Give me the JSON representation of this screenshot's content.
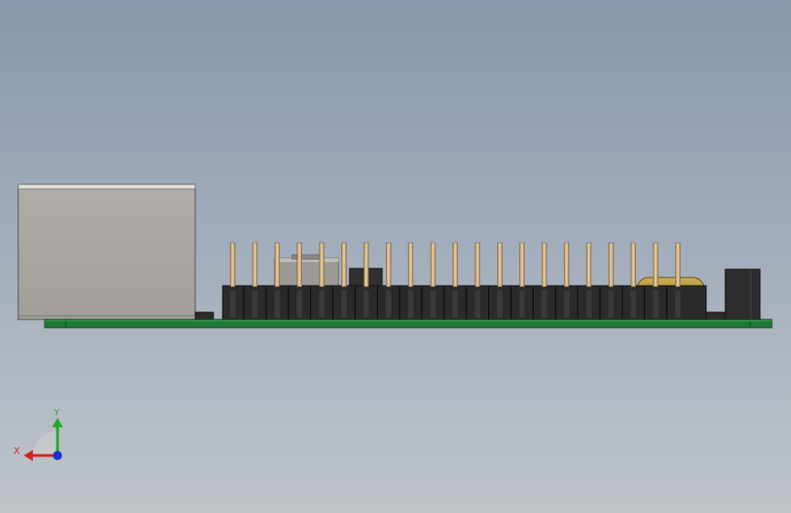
{
  "scene": {
    "kind": "cad-side-view",
    "background_top": "#8798ad",
    "background_bottom": "#bfc4c9"
  },
  "model": {
    "pcb_color": "#1f7a32",
    "pcb_edge_color": "#0c4a1a",
    "connector_housing_color": "#a9a6a1",
    "header_color": "#2a2a2a",
    "pin_color": "#d8b78a",
    "crystal_color": "#b59a3a",
    "header_pin_count": 21
  },
  "triad": {
    "x_label": "X",
    "y_label": "Y",
    "x_color": "#d42020",
    "y_color": "#1fa82c",
    "z_color": "#1a2fd0",
    "x_icon": "axis-x-arrow",
    "y_icon": "axis-y-arrow"
  }
}
